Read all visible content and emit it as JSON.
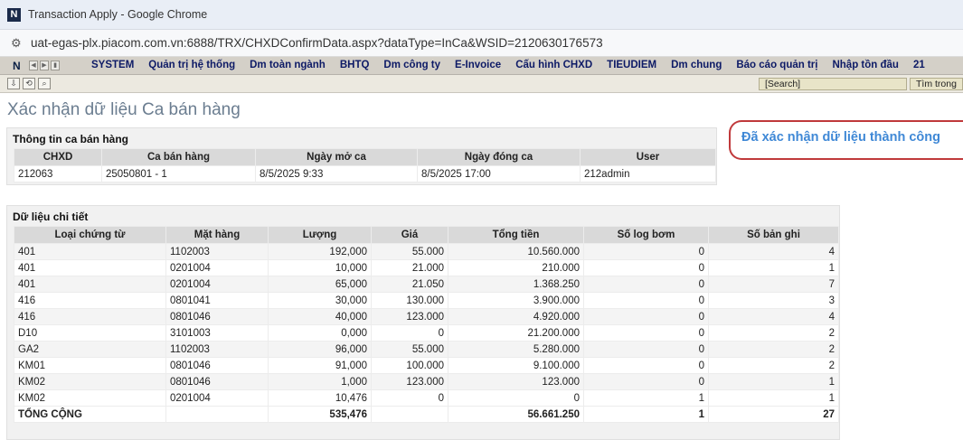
{
  "window": {
    "title": "Transaction Apply - Google Chrome",
    "url": "uat-egas-plx.piacom.com.vn:6888/TRX/CHXDConfirmData.aspx?dataType=InCa&WSID=2120630176573"
  },
  "menu": {
    "logo": "N",
    "items": [
      "SYSTEM",
      "Quản trị hệ thống",
      "Dm toàn ngành",
      "BHTQ",
      "Dm công ty",
      "E-Invoice",
      "Cấu hình CHXD",
      "TIEUDIEM",
      "Dm chung",
      "Báo cáo quản trị",
      "Nhập tồn đầu",
      "21"
    ]
  },
  "toolbar": {
    "search_placeholder": "[Search]",
    "find_in": "Tìm trong"
  },
  "page": {
    "title": "Xác nhận dữ liệu Ca bán hàng",
    "success_message": "Đã xác nhận dữ liệu thành công"
  },
  "shift_info": {
    "title": "Thông tin ca bán hàng",
    "columns": [
      "CHXD",
      "Ca bán hàng",
      "Ngày mở ca",
      "Ngày đóng ca",
      "User"
    ],
    "row": [
      "212063",
      "25050801 - 1",
      "8/5/2025 9:33",
      "8/5/2025 17:00",
      "212admin"
    ]
  },
  "detail": {
    "title": "Dữ liệu chi tiết",
    "columns": [
      "Loại chứng từ",
      "Mặt hàng",
      "Lượng",
      "Giá",
      "Tổng tiền",
      "Số log bơm",
      "Số bản ghi"
    ],
    "rows": [
      [
        "401",
        "1102003",
        "192,000",
        "55.000",
        "10.560.000",
        "0",
        "4"
      ],
      [
        "401",
        "0201004",
        "10,000",
        "21.000",
        "210.000",
        "0",
        "1"
      ],
      [
        "401",
        "0201004",
        "65,000",
        "21.050",
        "1.368.250",
        "0",
        "7"
      ],
      [
        "416",
        "0801041",
        "30,000",
        "130.000",
        "3.900.000",
        "0",
        "3"
      ],
      [
        "416",
        "0801046",
        "40,000",
        "123.000",
        "4.920.000",
        "0",
        "4"
      ],
      [
        "D10",
        "3101003",
        "0,000",
        "0",
        "21.200.000",
        "0",
        "2"
      ],
      [
        "GA2",
        "1102003",
        "96,000",
        "55.000",
        "5.280.000",
        "0",
        "2"
      ],
      [
        "KM01",
        "0801046",
        "91,000",
        "100.000",
        "9.100.000",
        "0",
        "2"
      ],
      [
        "KM02",
        "0801046",
        "1,000",
        "123.000",
        "123.000",
        "0",
        "1"
      ],
      [
        "KM02",
        "0201004",
        "10,476",
        "0",
        "0",
        "1",
        "1"
      ]
    ],
    "total": [
      "TỔNG CỘNG",
      "",
      "535,476",
      "",
      "56.661.250",
      "1",
      "27"
    ]
  }
}
